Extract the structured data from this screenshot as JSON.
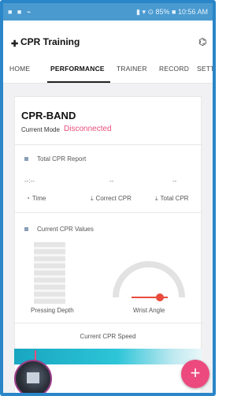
{
  "status_bar": {
    "left": "■ ■ ⌁",
    "right": "▮ ▾ ⊙ 85% ■ 10:56 AM"
  },
  "app": {
    "logo": "✚",
    "title": "CPR Training",
    "bluetooth": "⌬"
  },
  "tabs": [
    {
      "label": "HOME",
      "active": false
    },
    {
      "label": "PERFORMANCE",
      "active": true
    },
    {
      "label": "TRAINER",
      "active": false
    },
    {
      "label": "RECORD",
      "active": false
    },
    {
      "label": "SETTI",
      "active": false
    }
  ],
  "device": {
    "name": "CPR-BAND",
    "mode_label": "Current Mode",
    "mode_value": "Disconnected"
  },
  "report": {
    "title": "Total CPR Report",
    "stats": [
      {
        "value": "--:--",
        "label": "Time",
        "icon": "clock-icon"
      },
      {
        "value": "--",
        "label": "Correct CPR",
        "icon": "download-icon"
      },
      {
        "value": "--",
        "label": "Total CPR",
        "icon": "download-icon"
      }
    ]
  },
  "values": {
    "title": "Current CPR Values",
    "depth_label": "Pressing Depth",
    "angle_label": "Wrist Angle"
  },
  "speed": {
    "title": "Current CPR Speed"
  },
  "fab": {
    "label": "+"
  },
  "colors": {
    "accent": "#ec4a7e",
    "status_bar": "#4a9ad0",
    "frame": "#2a86c8",
    "mode_value": "#e94b7a",
    "gauge_needle": "#e94b3c"
  }
}
